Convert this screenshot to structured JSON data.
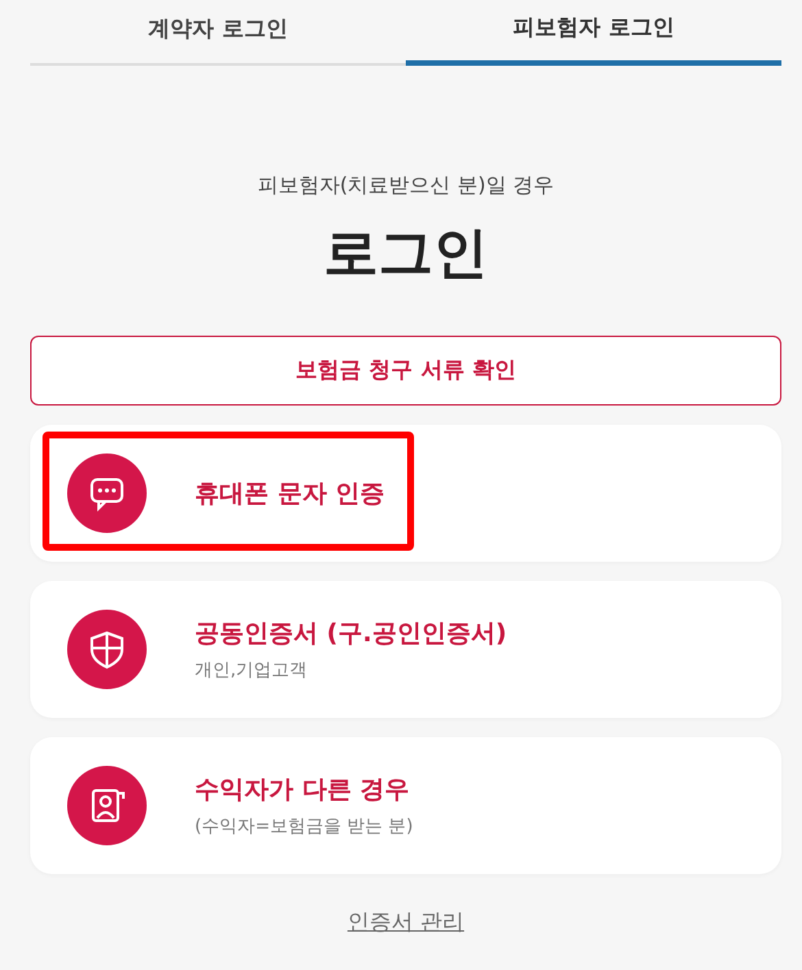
{
  "tabs": [
    {
      "label": "계약자 로그인",
      "selected": false
    },
    {
      "label": "피보험자 로그인",
      "selected": true
    }
  ],
  "subtitle": "피보험자(치료받으신 분)일 경우",
  "title": "로그인",
  "check_button": "보험금 청구 서류 확인",
  "options": [
    {
      "kind": "chat",
      "label": "휴대폰 문자 인증",
      "highlighted": true
    },
    {
      "kind": "shield",
      "label": "공동인증서 (구.공인인증서)",
      "note": "개인,기업고객",
      "highlighted": false
    },
    {
      "kind": "person",
      "label": "수익자가 다른 경우",
      "note": "(수익자=보험금을 받는 분)",
      "highlighted": false
    }
  ],
  "footer_link": "인증서 관리"
}
